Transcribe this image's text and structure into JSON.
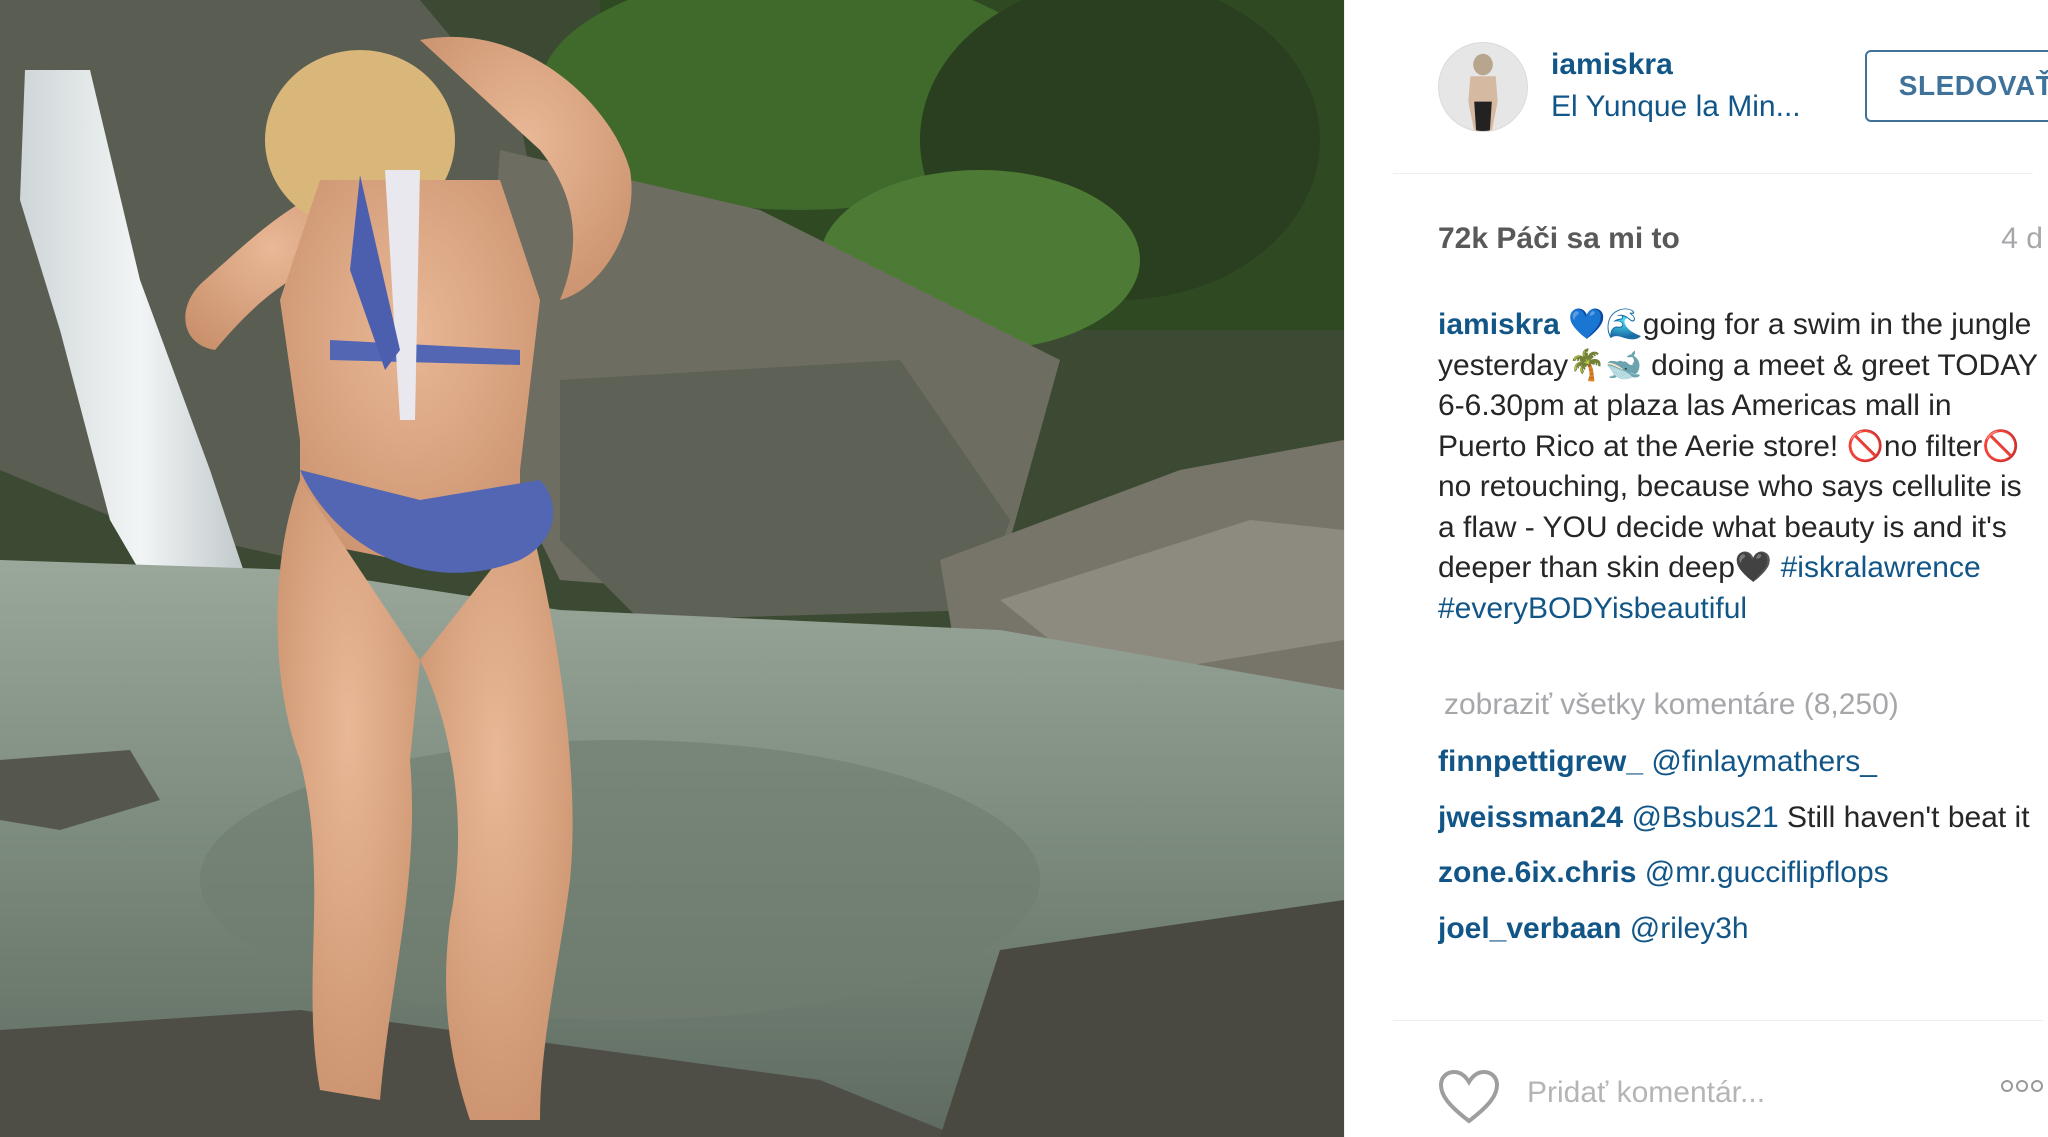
{
  "post": {
    "username": "iamiskra",
    "location": "El Yunque la Min...",
    "follow_label": "SLEDOVAŤ",
    "likes": "72k Páči sa mi to",
    "age": "4 d"
  },
  "caption": {
    "username": "iamiskra",
    "text": " 💙🌊going for a swim in the jungle yesterday🌴🐋 doing a meet & greet TODAY 6-6.30pm at plaza las Americas mall in Puerto Rico at the Aerie store! 🚫no filter🚫 no retouching, because who says cellulite is a flaw - YOU decide what beauty is and it's deeper than skin deep🖤 ",
    "hashtag1": "#iskralawrence",
    "hashtag2": "#everyBODYisbeautiful"
  },
  "view_all": "zobraziť všetky komentáre (8,250)",
  "comments": [
    {
      "user": "finnpettigrew_",
      "mention": "@finlaymathers_",
      "text": ""
    },
    {
      "user": "jweissman24",
      "mention": "@Bsbus21",
      "text": " Still haven't beat it"
    },
    {
      "user": "zone.6ix.chris",
      "mention": "@mr.gucciflipflops",
      "text": ""
    },
    {
      "user": "joel_verbaan",
      "mention": "@riley3h",
      "text": ""
    }
  ],
  "footer": {
    "comment_placeholder": "Pridať komentár..."
  },
  "colors": {
    "link": "#125688",
    "follow": "#3f729b",
    "muted": "#a5a7aa"
  },
  "icons": {
    "like": "heart-icon",
    "more": "more-options-icon"
  }
}
